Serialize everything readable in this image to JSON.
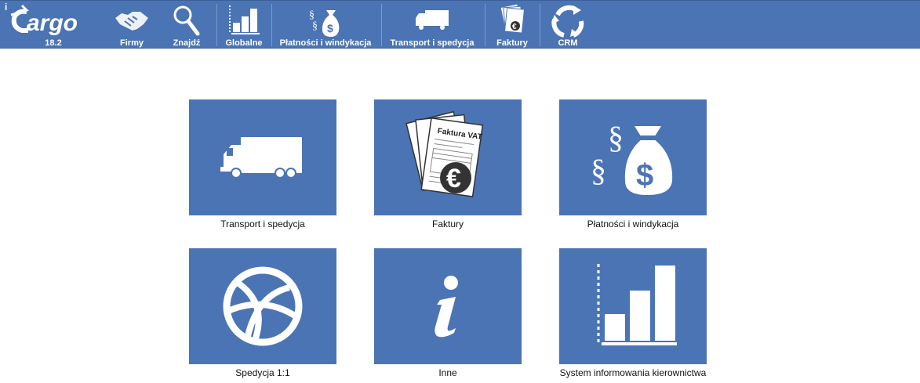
{
  "app": {
    "logo_text": "iCargo",
    "version": "18.2"
  },
  "nav": {
    "firmy": "Firmy",
    "znajdz": "Znajdź",
    "globalne": "Globalne",
    "platnosci": "Płatności i windykacja",
    "transport": "Transport i spedycja",
    "faktury": "Faktury",
    "crm": "CRM"
  },
  "tiles": {
    "transport": "Transport i spedycja",
    "faktury": "Faktury",
    "faktury_doc_title": "Faktura VAT",
    "platnosci": "Płatności i windykacja",
    "spedycja": "Spedycja 1:1",
    "inne": "Inne",
    "system": "System informowania kierownictwa"
  },
  "colors": {
    "bar": "#4a74b4",
    "tile": "#4a74b4",
    "icon": "#ffffff"
  }
}
